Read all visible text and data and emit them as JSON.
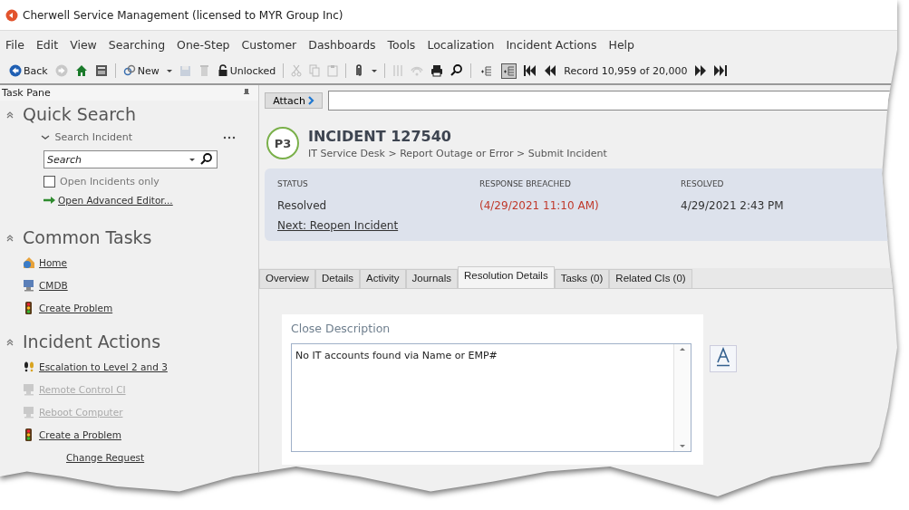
{
  "window": {
    "title": "Cherwell Service Management (licensed to MYR Group Inc)"
  },
  "menu": [
    "File",
    "Edit",
    "View",
    "Searching",
    "One-Step",
    "Customer",
    "Dashboards",
    "Tools",
    "Localization",
    "Incident Actions",
    "Help"
  ],
  "toolbar": {
    "back": "Back",
    "new": "New",
    "lock": "Unlocked",
    "record": "Record 10,959 of 20,000",
    "toggles": [
      {
        "pressed": false
      },
      {
        "pressed": true
      }
    ]
  },
  "task_pane": {
    "title": "Task Pane",
    "sections": [
      {
        "kind": "search",
        "title": "Quick Search",
        "expanded": true,
        "scope": "Search Incident",
        "field": {
          "placeholder": "Search"
        },
        "checkbox": {
          "label": "Open Incidents only",
          "checked": false
        },
        "link": "Open Advanced Editor..."
      },
      {
        "kind": "links",
        "title": "Common Tasks",
        "expanded": true,
        "items": [
          {
            "kind": "home",
            "label": "Home",
            "disabled": false
          },
          {
            "kind": "computer",
            "label": "CMDB",
            "disabled": false
          },
          {
            "kind": "traffic",
            "label": "Create Problem",
            "disabled": false
          }
        ]
      },
      {
        "kind": "links",
        "title": "Incident Actions",
        "expanded": true,
        "items": [
          {
            "kind": "steps",
            "label": "Escalation to Level 2 and 3",
            "disabled": false
          },
          {
            "kind": "computer",
            "label": "Remote Control CI",
            "disabled": true
          },
          {
            "kind": "computer",
            "label": "Reboot Computer",
            "disabled": true
          },
          {
            "kind": "traffic",
            "label": "Create a Problem",
            "disabled": false
          },
          {
            "kind": "plain",
            "label": "Change Request",
            "disabled": false
          }
        ]
      }
    ]
  },
  "attach": {
    "label": "Attach"
  },
  "incident": {
    "priority": "P3",
    "title": "INCIDENT 127540",
    "breadcrumb": "IT Service Desk > Report Outage or Error > Submit Incident",
    "fields": [
      {
        "label": "STATUS",
        "value": "Resolved",
        "breached": false
      },
      {
        "label": "RESPONSE BREACHED",
        "value": "(4/29/2021 11:10 AM)",
        "breached": true
      },
      {
        "label": "RESOLVED",
        "value": "4/29/2021 2:43 PM",
        "breached": false
      }
    ],
    "next": "Next: Reopen Incident"
  },
  "tabs": [
    {
      "label": "Overview",
      "selected": false
    },
    {
      "label": "Details",
      "selected": false
    },
    {
      "label": "Activity",
      "selected": false
    },
    {
      "label": "Journals",
      "selected": false
    },
    {
      "label": "Resolution Details",
      "selected": true
    },
    {
      "label": "Tasks (0)",
      "selected": false
    },
    {
      "label": "Related CIs (0)",
      "selected": false
    }
  ],
  "close_description": {
    "label": "Close Description",
    "value": "No IT accounts found via Name or EMP#"
  }
}
